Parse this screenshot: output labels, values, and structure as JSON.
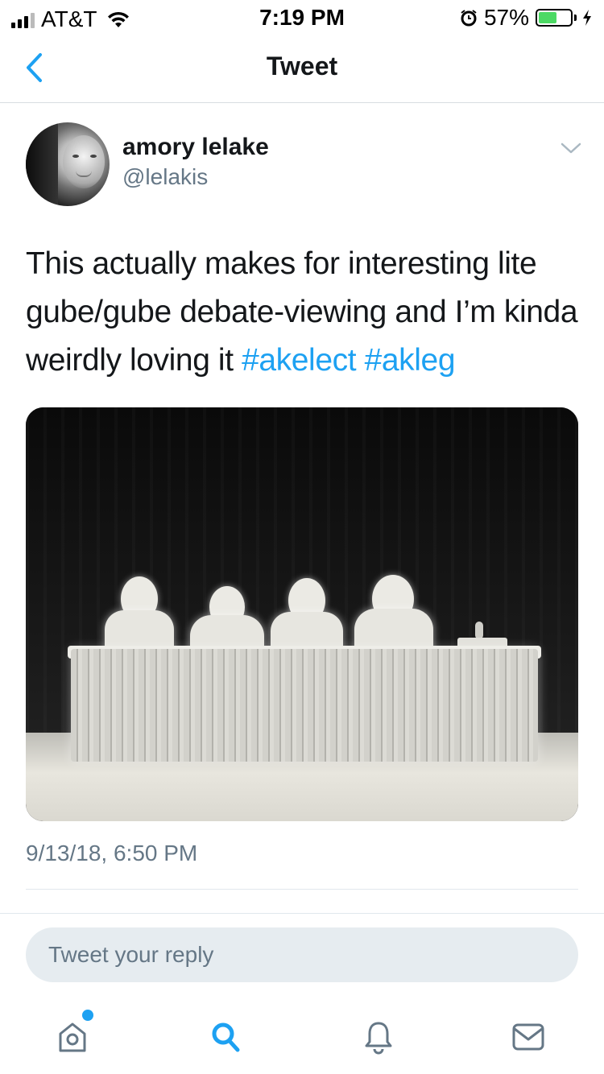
{
  "status_bar": {
    "carrier": "AT&T",
    "time": "7:19 PM",
    "battery_percent": "57%",
    "battery_level": 0.57,
    "icons": [
      "signal-icon",
      "wifi-icon",
      "alarm-icon",
      "battery-icon",
      "charging-icon"
    ]
  },
  "nav": {
    "title": "Tweet",
    "back_icon": "chevron-left-icon"
  },
  "tweet": {
    "author_name": "amory lelake",
    "author_handle": "@lelakis",
    "text_plain": "This actually makes for interesting lite gube/gube debate-viewing and I’m kinda weirdly loving it",
    "hashtags": [
      "#akelect",
      "#akleg"
    ],
    "timestamp": "9/13/18, 6:50 PM",
    "media_alt": ""
  },
  "reply": {
    "placeholder": "Tweet your reply"
  },
  "tab_bar": {
    "items": [
      "home-icon",
      "search-icon",
      "notifications-icon",
      "messages-icon"
    ],
    "accent": "#1da1f2"
  },
  "colors": {
    "accent": "#1da1f2",
    "text_primary": "#14171a",
    "text_secondary": "#657786",
    "reply_bg": "#e6ecf0"
  }
}
